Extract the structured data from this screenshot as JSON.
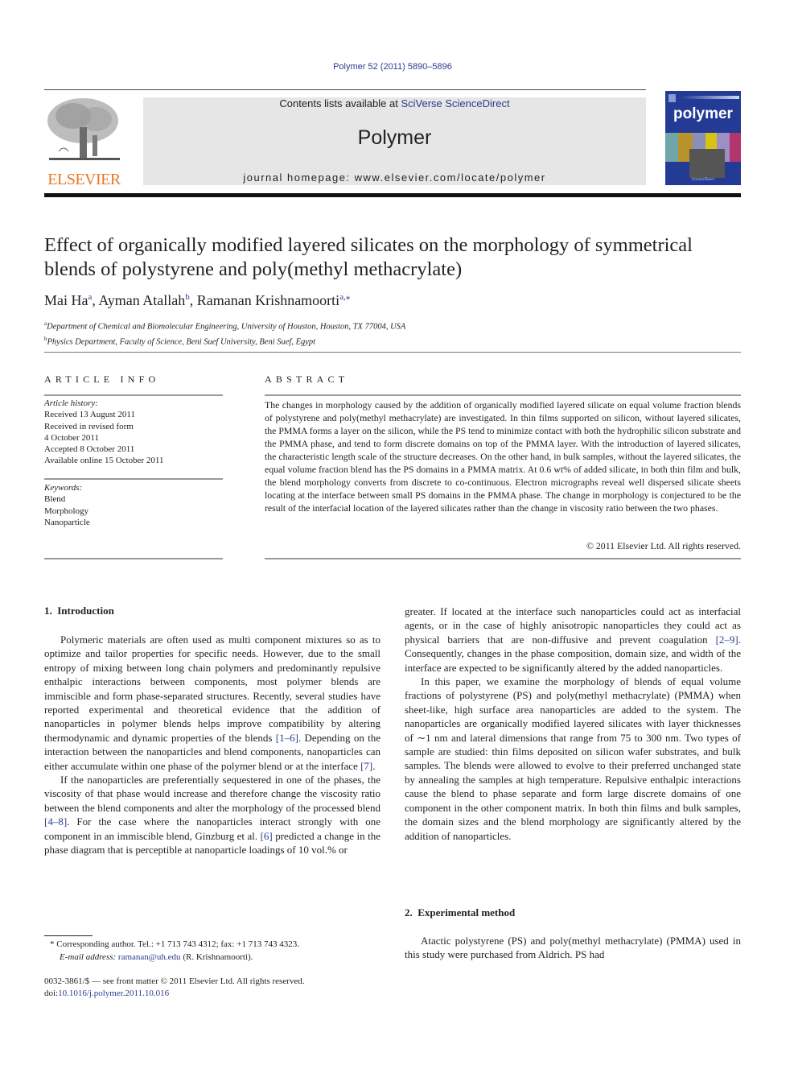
{
  "header": {
    "citation": "Polymer 52 (2011) 5890–5896",
    "contents_prefix": "Contents lists available at ",
    "contents_link": "SciVerse ScienceDirect",
    "journal_name": "Polymer",
    "homepage": "journal homepage: www.elsevier.com/locate/polymer",
    "publisher_logo_text": "ELSEVIER",
    "cover_title": "polymer",
    "publisher_logo_icon": "elsevier-tree-icon"
  },
  "article": {
    "title": "Effect of organically modified layered silicates on the morphology of symmetrical blends of polystyrene and poly(methyl methacrylate)",
    "authors": [
      {
        "name": "Mai Ha",
        "sup": "a"
      },
      {
        "name": "Ayman Atallah",
        "sup": "b"
      },
      {
        "name": "Ramanan Krishnamoorti",
        "sup": "a,⁎"
      }
    ],
    "affiliations": [
      {
        "sup": "a",
        "text": "Department of Chemical and Biomolecular Engineering, University of Houston, Houston, TX 77004, USA"
      },
      {
        "sup": "b",
        "text": "Physics Department, Faculty of Science, Beni Suef University, Beni Suef, Egypt"
      }
    ]
  },
  "article_info": {
    "label": "ARTICLE INFO",
    "history_label": "Article history:",
    "history": [
      "Received 13 August 2011",
      "Received in revised form",
      "4 October 2011",
      "Accepted 8 October 2011",
      "Available online 15 October 2011"
    ],
    "keywords_label": "Keywords:",
    "keywords": [
      "Blend",
      "Morphology",
      "Nanoparticle"
    ]
  },
  "abstract": {
    "label": "ABSTRACT",
    "text": "The changes in morphology caused by the addition of organically modified layered silicate on equal volume fraction blends of polystyrene and poly(methyl methacrylate) are investigated. In thin films supported on silicon, without layered silicates, the PMMA forms a layer on the silicon, while the PS tend to minimize contact with both the hydrophilic silicon substrate and the PMMA phase, and tend to form discrete domains on top of the PMMA layer. With the introduction of layered silicates, the characteristic length scale of the structure decreases. On the other hand, in bulk samples, without the layered silicates, the equal volume fraction blend has the PS domains in a PMMA matrix. At 0.6 wt% of added silicate, in both thin film and bulk, the blend morphology converts from discrete to co-continuous. Electron micrographs reveal well dispersed silicate sheets locating at the interface between small PS domains in the PMMA phase. The change in morphology is conjectured to be the result of the interfacial location of the layered silicates rather than the change in viscosity ratio between the two phases.",
    "copyright": "© 2011 Elsevier Ltd. All rights reserved."
  },
  "body": {
    "section1_heading": "1.  Introduction",
    "intro_p1_a": "Polymeric materials are often used as multi component mixtures so as to optimize and tailor properties for specific needs. However, due to the small entropy of mixing between long chain polymers and predominantly repulsive enthalpic interactions between components, most polymer blends are immiscible and form phase-separated structures. Recently, several studies have reported experimental and theoretical evidence that the addition of nanoparticles in polymer blends helps improve compatibility by altering thermodynamic and dynamic properties of the blends ",
    "intro_p1_ref1": "[1–6]",
    "intro_p1_b": ". Depending on the interaction between the nanoparticles and blend components, nanoparticles can either accumulate within one phase of the polymer blend or at the interface ",
    "intro_p1_ref2": "[7]",
    "intro_p1_c": ".",
    "intro_p2_a": "If the nanoparticles are preferentially sequestered in one of the phases, the viscosity of that phase would increase and therefore change the viscosity ratio between the blend components and alter the morphology of the processed blend ",
    "intro_p2_ref1": "[4–8]",
    "intro_p2_b": ". For the case where the nanoparticles interact strongly with one component in an immiscible blend, Ginzburg et al. ",
    "intro_p2_ref2": "[6]",
    "intro_p2_c": " predicted a change in the phase diagram that is perceptible at nanoparticle loadings of 10 vol.% or",
    "col2_p1_a": "greater. If located at the interface such nanoparticles could act as interfacial agents, or in the case of highly anisotropic nanoparticles they could act as physical barriers that are non-diffusive and prevent coagulation ",
    "col2_p1_ref": "[2–9]",
    "col2_p1_b": ". Consequently, changes in the phase composition, domain size, and width of the interface are expected to be significantly altered by the added nanoparticles.",
    "col2_p2": "In this paper, we examine the morphology of blends of equal volume fractions of polystyrene (PS) and poly(methyl methacrylate) (PMMA) when sheet-like, high surface area nanoparticles are added to the system. The nanoparticles are organically modified layered silicates with layer thicknesses of ∼1 nm and lateral dimensions that range from 75 to 300 nm. Two types of sample are studied: thin films deposited on silicon wafer substrates, and bulk samples. The blends were allowed to evolve to their preferred unchanged state by annealing the samples at high temperature. Repulsive enthalpic interactions cause the blend to phase separate and form large discrete domains of one component in the other component matrix. In both thin films and bulk samples, the domain sizes and the blend morphology are significantly altered by the addition of nanoparticles.",
    "section2_heading": "2.  Experimental method",
    "sec2_p1": "Atactic polystyrene (PS) and poly(methyl methacrylate) (PMMA) used in this study were purchased from Aldrich. PS had"
  },
  "footnote": {
    "star": "*",
    "corresponding": " Corresponding author. Tel.: +1 713 743 4312; fax: +1 713 743 4323.",
    "email_label": "E-mail address:",
    "email": "ramanan@uh.edu",
    "email_suffix": " (R. Krishnamoorti)."
  },
  "front_matter": {
    "issn_line": "0032-3861/$ — see front matter © 2011 Elsevier Ltd. All rights reserved.",
    "doi_prefix": "doi:",
    "doi": "10.1016/j.polymer.2011.10.016"
  },
  "colors": {
    "link": "#2a3c8f",
    "elsevier_orange": "#e87722",
    "cover_blue": "#233b95",
    "journal_box": "#e6e6e6"
  }
}
